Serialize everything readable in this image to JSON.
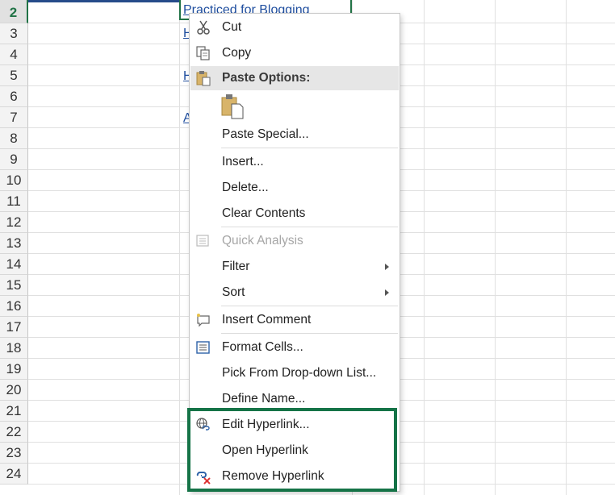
{
  "sheet": {
    "rows": [
      "2",
      "3",
      "4",
      "5",
      "6",
      "7",
      "8",
      "9",
      "10",
      "11",
      "12",
      "13",
      "14",
      "15",
      "16",
      "17",
      "18",
      "19",
      "20",
      "21",
      "22",
      "23",
      "24"
    ],
    "cells": {
      "b2": "Practiced for Blogging",
      "b3": "H",
      "b5": "H",
      "b7": "A"
    }
  },
  "menu": {
    "cut": "Cut",
    "copy": "Copy",
    "paste_options": "Paste Options:",
    "paste_special": "Paste Special...",
    "insert": "Insert...",
    "delete": "Delete...",
    "clear_contents": "Clear Contents",
    "quick_analysis": "Quick Analysis",
    "filter": "Filter",
    "sort": "Sort",
    "insert_comment": "Insert Comment",
    "format_cells": "Format Cells...",
    "pick_from_list": "Pick From Drop-down List...",
    "define_name": "Define Name...",
    "edit_hyperlink": "Edit Hyperlink...",
    "open_hyperlink": "Open Hyperlink",
    "remove_hyperlink": "Remove Hyperlink"
  },
  "colors": {
    "selection_green": "#217346",
    "highlight_box": "#157347",
    "hyperlink_blue": "#1f4e9f"
  }
}
